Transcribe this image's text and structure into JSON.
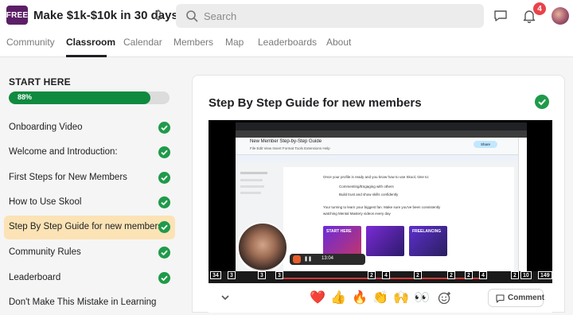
{
  "header": {
    "logo_text": "FREE",
    "group_title": "Make $1k-$10k in 30 days",
    "search_placeholder": "Search",
    "notification_count": "4"
  },
  "tabs": [
    "Community",
    "Classroom",
    "Calendar",
    "Members",
    "Map",
    "Leaderboards",
    "About"
  ],
  "active_tab": "Classroom",
  "sidebar": {
    "course_title": "START HERE",
    "progress_percent": 88,
    "progress_label": "88%",
    "lessons": [
      {
        "label": "Onboarding Video",
        "completed": true
      },
      {
        "label": "Welcome and Introduction:",
        "completed": true
      },
      {
        "label": "First Steps for New Members",
        "completed": true
      },
      {
        "label": "How to Use Skool",
        "completed": true
      },
      {
        "label": "Step By Step Guide for new members",
        "completed": true,
        "active": true
      },
      {
        "label": "Community Rules",
        "completed": true
      },
      {
        "label": "Leaderboard",
        "completed": true
      },
      {
        "label": "Don't Make This Mistake in Learning",
        "completed": false
      }
    ]
  },
  "main": {
    "lesson_title": "Step By Step Guide for new members",
    "video": {
      "doc_title": "New Member Step-by-Step Guide",
      "doc_menu": "File  Edit  View  Insert  Format  Tools  Extensions  Help",
      "share_label": "Share",
      "page_line1": "Once your profile is ready and you know how to use Skool, time to:",
      "page_line2": "Commenting/Engaging with others",
      "page_line3": "Build trust and show skills confidently",
      "page_line4": "Your turning to learn your biggest fan. Make sure you've been consistently",
      "page_line5": "watching Mental Mastery videos every day",
      "thumb_captions": [
        "START HERE",
        "",
        "FREELANCING"
      ],
      "rec_time": "13:04",
      "taskbar_badges": [
        "34",
        "3",
        "3",
        "3",
        "2",
        "4",
        "2",
        "2",
        "2",
        "4",
        "2",
        "10",
        "149"
      ]
    },
    "reactions": [
      "❤️",
      "👍",
      "🔥",
      "👏",
      "🙌",
      "👀"
    ],
    "comment_label": "Comment"
  },
  "colors": {
    "brand": "#5b1f66",
    "progress": "#0f8a3f",
    "active_lesson_bg": "#fbe3b5",
    "check": "#1f9a4a",
    "badge": "#e8434a"
  }
}
